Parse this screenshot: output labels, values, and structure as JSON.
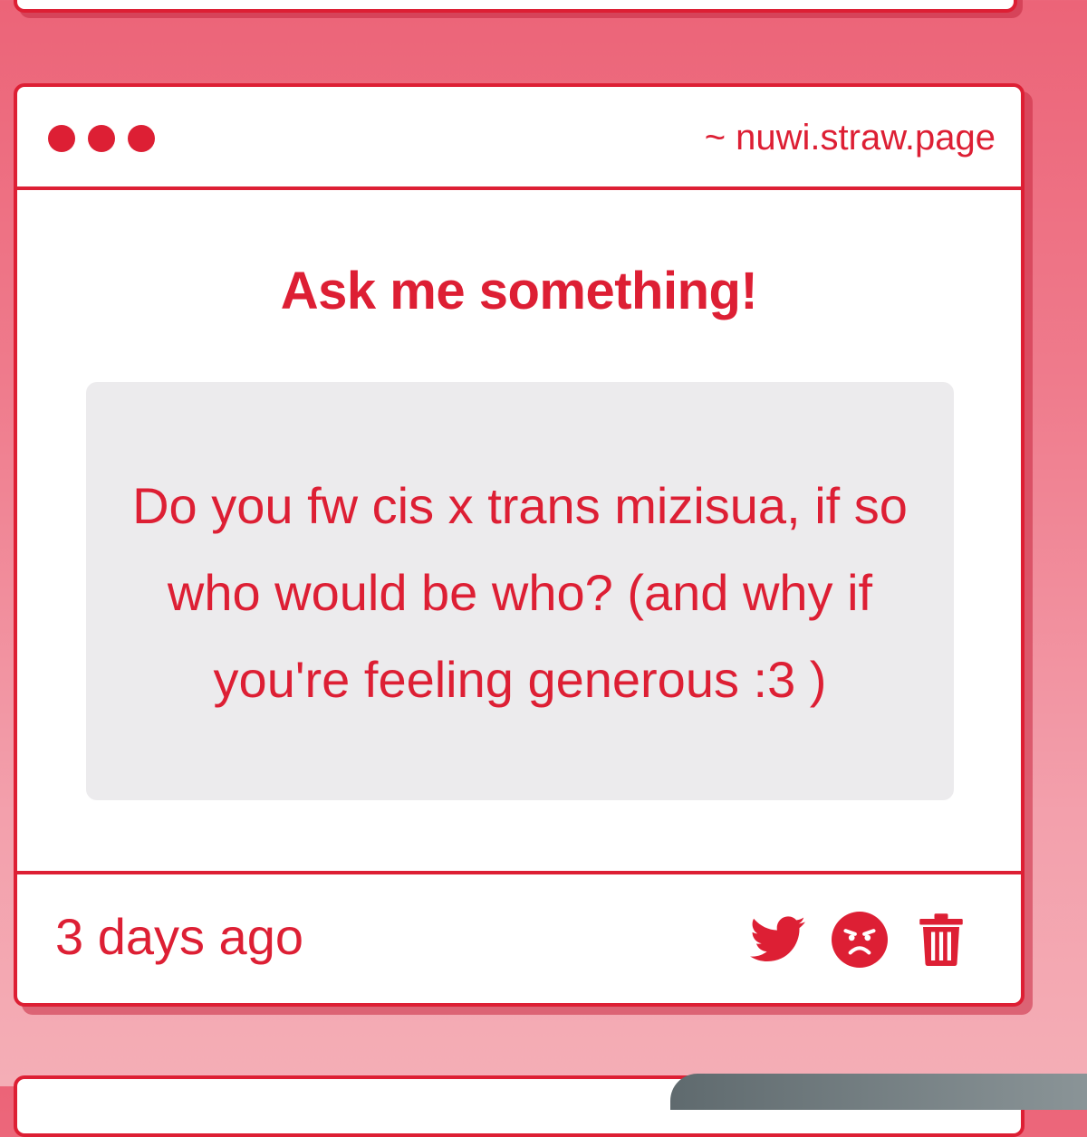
{
  "card": {
    "url": "~ nuwi.straw.page",
    "heading": "Ask me something!",
    "question": "Do you fw cis x trans mizisua, if so who would be who? (and why if you're feeling generous :3 )",
    "timestamp": "3 days ago",
    "actions": [
      {
        "icon": "twitter-icon"
      },
      {
        "icon": "angry-face-icon"
      },
      {
        "icon": "trash-icon"
      }
    ]
  },
  "colors": {
    "accent": "#dd1f34",
    "question_bg": "#ecebed",
    "page_bg_top": "#ec6478",
    "page_bg_bottom": "#f4aeb6"
  }
}
